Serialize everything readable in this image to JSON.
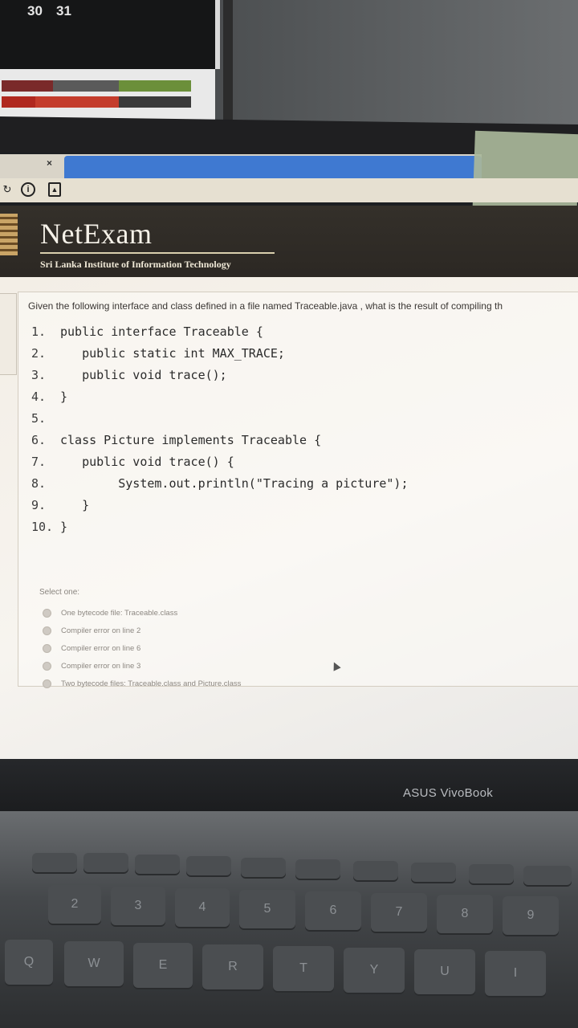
{
  "scene": {
    "calendar_dates": [
      "30",
      "31"
    ],
    "laptop_brand": "ASUS VivoBook"
  },
  "browser": {
    "tab_close_glyph": "×",
    "toolbar_icons": [
      "reload-icon",
      "info-icon",
      "page-icon"
    ]
  },
  "site": {
    "title": "NetExam",
    "subtitle": "Sri Lanka Institute of Information Technology"
  },
  "question": {
    "prompt": "Given the following interface and class defined in a file named Traceable.java , what is the result of compiling th",
    "code_lines": [
      {
        "num": "1.",
        "text": "public interface Traceable {"
      },
      {
        "num": "2.",
        "text": "   public static int MAX_TRACE;"
      },
      {
        "num": "3.",
        "text": "   public void trace();"
      },
      {
        "num": "4.",
        "text": "}"
      },
      {
        "num": "5.",
        "text": ""
      },
      {
        "num": "6.",
        "text": "class Picture implements Traceable {"
      },
      {
        "num": "7.",
        "text": "   public void trace() {"
      },
      {
        "num": "8.",
        "text": "        System.out.println(\"Tracing a picture\");"
      },
      {
        "num": "9.",
        "text": "   }"
      },
      {
        "num": "10.",
        "text": "}"
      }
    ],
    "select_label": "Select one:",
    "options": [
      "One bytecode file: Traceable.class",
      "Compiler error on line 2",
      "Compiler error on line 6",
      "Compiler error on line 3",
      "Two bytecode files: Traceable.class and Picture.class"
    ]
  },
  "keyboard": {
    "number_keys": [
      "2",
      "3",
      "4",
      "5",
      "6",
      "7",
      "8",
      "9"
    ],
    "letter_keys": [
      "Q",
      "W",
      "E",
      "R",
      "T",
      "Y",
      "U",
      "I"
    ]
  }
}
